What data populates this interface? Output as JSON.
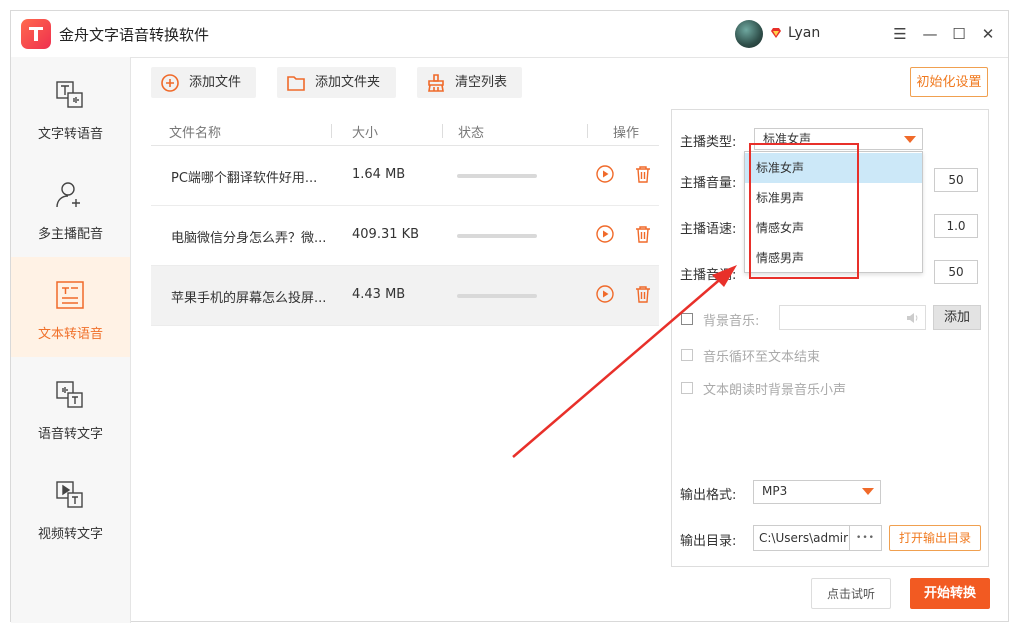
{
  "app": {
    "title": "金舟文字语音转换软件"
  },
  "user": {
    "name": "Lyan"
  },
  "window_controls": {
    "menu": "☰",
    "minimize": "—",
    "maximize": "☐",
    "close": "✕"
  },
  "sidebar": {
    "items": [
      {
        "label": "文字转语音",
        "icon": "text-to-speech-icon",
        "active": false
      },
      {
        "label": "多主播配音",
        "icon": "user-add-icon",
        "active": false
      },
      {
        "label": "文本转语音",
        "icon": "document-text-icon",
        "active": true
      },
      {
        "label": "语音转文字",
        "icon": "speech-to-text-icon",
        "active": false
      },
      {
        "label": "视频转文字",
        "icon": "video-to-text-icon",
        "active": false
      }
    ]
  },
  "toolbar": {
    "add_file": "添加文件",
    "add_folder": "添加文件夹",
    "clear_list": "清空列表",
    "init_settings": "初始化设置"
  },
  "table": {
    "columns": {
      "name": "文件名称",
      "size": "大小",
      "status": "状态",
      "actions": "操作"
    },
    "rows": [
      {
        "name": "PC端哪个翻译软件好用...",
        "size": "1.64 MB"
      },
      {
        "name": "电脑微信分身怎么弄？微...",
        "size": "409.31 KB"
      },
      {
        "name": "苹果手机的屏幕怎么投屏...",
        "size": "4.43 MB"
      }
    ]
  },
  "settings": {
    "anchor_type_label": "主播类型:",
    "anchor_type_value": "标准女声",
    "volume_label": "主播音量:",
    "volume_value": "50",
    "speed_label": "主播语速:",
    "speed_value": "1.0",
    "pitch_label": "主播音调:",
    "pitch_value": "50",
    "bgm_label": "背景音乐:",
    "bgm_add": "添加",
    "loop_label": "音乐循环至文本结束",
    "lower_label": "文本朗读时背景音乐小声",
    "format_label": "输出格式:",
    "format_value": "MP3",
    "output_dir_label": "输出目录:",
    "output_dir_value": "C:\\Users\\admir",
    "output_dir_more": "•••",
    "open_output": "打开输出目录"
  },
  "dropdown": {
    "options": [
      "标准女声",
      "标准男声",
      "情感女声",
      "情感男声"
    ]
  },
  "footer": {
    "preview": "点击试听",
    "start": "开始转换"
  },
  "colors": {
    "accent": "#f06a2a",
    "annotation_red": "#e8302a",
    "highlight": "#cce8f8"
  }
}
